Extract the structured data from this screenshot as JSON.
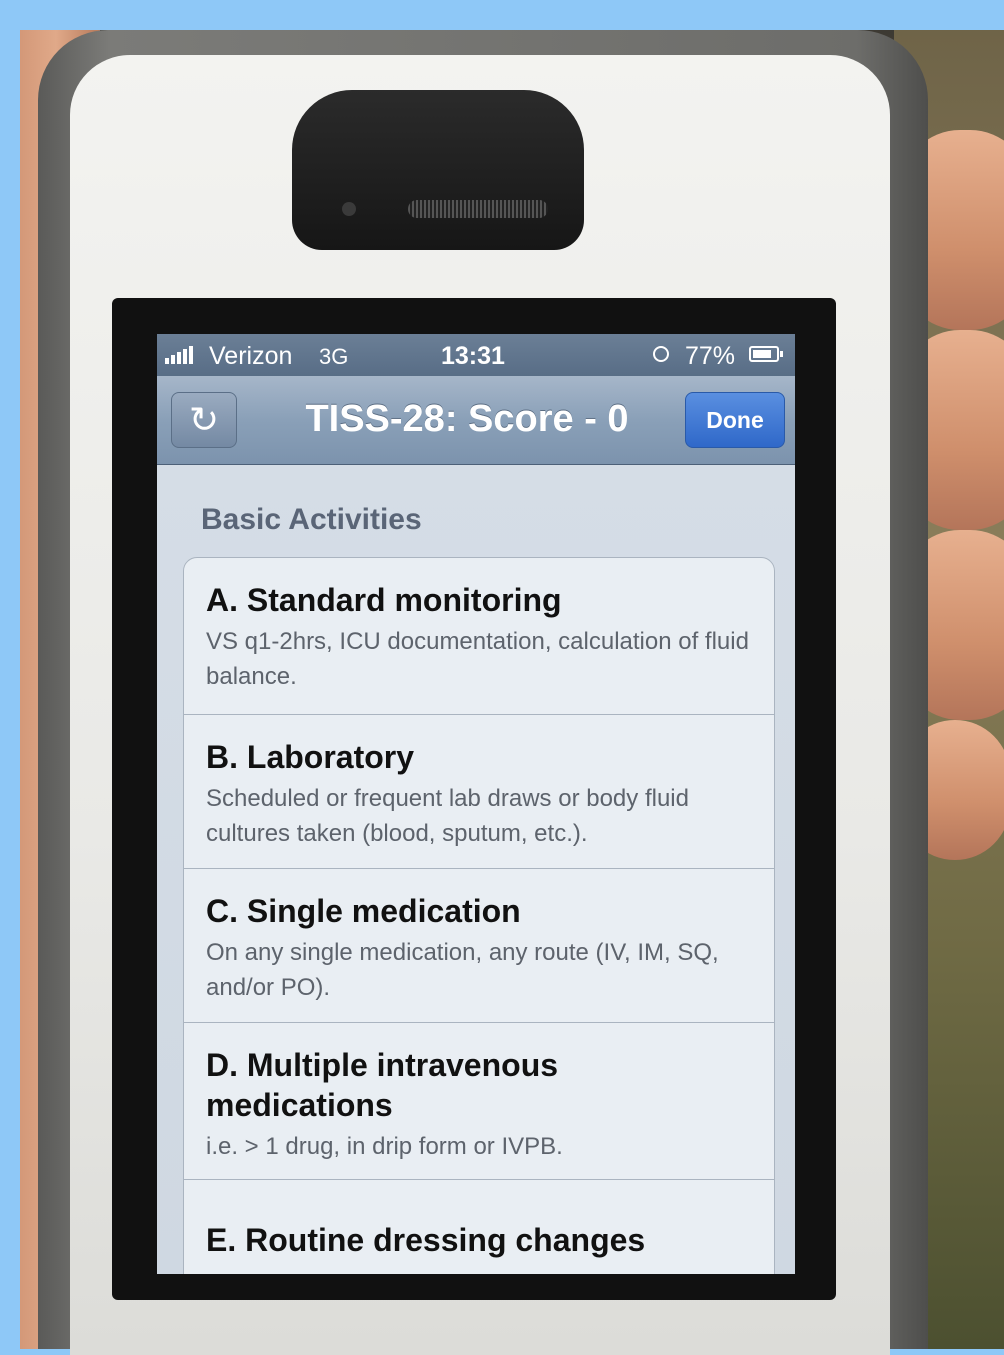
{
  "status_bar": {
    "carrier": "Verizon",
    "network": "3G",
    "time": "13:31",
    "battery": "77%"
  },
  "nav_bar": {
    "title": "TISS-28: Score - 0",
    "done_label": "Done",
    "refresh_icon": "refresh-icon",
    "refresh_glyph": "↻"
  },
  "section": {
    "header": "Basic Activities"
  },
  "items": [
    {
      "title": "A. Standard monitoring",
      "description": "VS q1-2hrs, ICU documentation, calculation of fluid balance."
    },
    {
      "title": "B. Laboratory",
      "description": "Scheduled or frequent lab draws or body fluid cultures taken (blood, sputum, etc.)."
    },
    {
      "title": "C. Single medication",
      "description": "On any single medication, any route (IV, IM, SQ, and/or PO)."
    },
    {
      "title": "D. Multiple intravenous medications",
      "description": "i.e. > 1 drug, in drip form or IVPB."
    },
    {
      "title": "E. Routine dressing changes",
      "description": ""
    }
  ],
  "colors": {
    "nav_bar": "#8aa0b8",
    "done_button": "#2f68c9",
    "background": "#8ec8f7"
  }
}
